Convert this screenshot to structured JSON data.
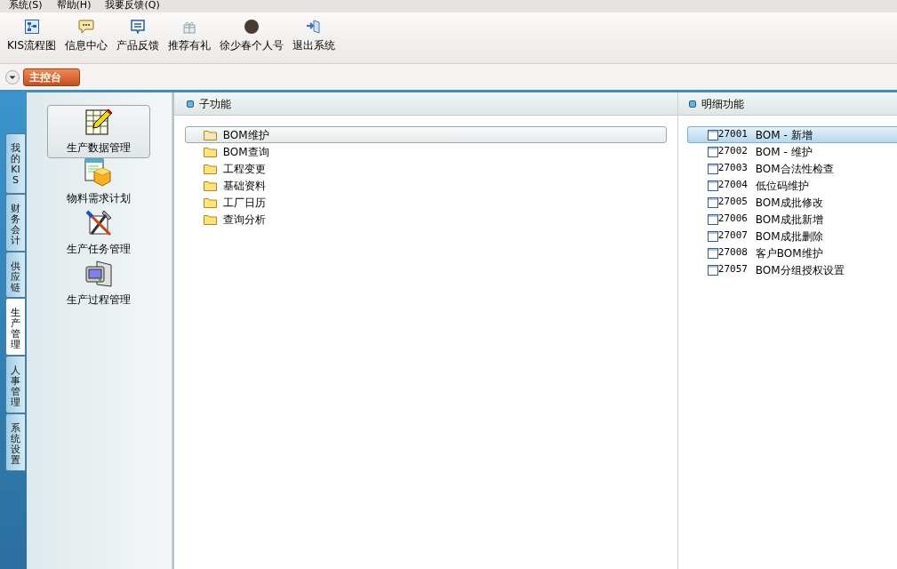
{
  "menu": [
    "系统(S)",
    "帮助(H)",
    "我要反馈(Q)"
  ],
  "toolbar": [
    {
      "label": "KIS流程图",
      "kind": "flow"
    },
    {
      "label": "信息中心",
      "kind": "message"
    },
    {
      "label": "产品反馈",
      "kind": "feedback"
    },
    {
      "label": "推荐有礼",
      "kind": "gift"
    },
    {
      "label": "徐少春个人号",
      "kind": "avatar"
    },
    {
      "label": "退出系统",
      "kind": "exit"
    }
  ],
  "tabs": [
    {
      "label": "主控台",
      "selected": true
    }
  ],
  "side_tabs": [
    {
      "label": "我的KIS",
      "selected": false
    },
    {
      "label": "财务会计",
      "selected": false
    },
    {
      "label": "供应链",
      "selected": false
    },
    {
      "label": "生产管理",
      "selected": true
    },
    {
      "label": "人事管理",
      "selected": false
    },
    {
      "label": "系统设置",
      "selected": false
    }
  ],
  "modules": [
    {
      "label": "生产数据管理",
      "kind": "table",
      "selected": true
    },
    {
      "label": "物料需求计划",
      "kind": "box",
      "selected": false
    },
    {
      "label": "生产任务管理",
      "kind": "tools",
      "selected": false
    },
    {
      "label": "生产过程管理",
      "kind": "terminal",
      "selected": false
    }
  ],
  "subfunctions": {
    "title": "子功能",
    "items": [
      {
        "label": "BOM维护",
        "selected": true
      },
      {
        "label": "BOM查询",
        "selected": false
      },
      {
        "label": "工程变更",
        "selected": false
      },
      {
        "label": "基础资料",
        "selected": false
      },
      {
        "label": "工厂日历",
        "selected": false
      },
      {
        "label": "查询分析",
        "selected": false
      }
    ]
  },
  "details": {
    "title": "明细功能",
    "items": [
      {
        "code": "27001",
        "label": "BOM - 新增",
        "selected": true
      },
      {
        "code": "27002",
        "label": "BOM - 维护",
        "selected": false
      },
      {
        "code": "27003",
        "label": "BOM合法性检查",
        "selected": false
      },
      {
        "code": "27004",
        "label": "低位码维护",
        "selected": false
      },
      {
        "code": "27005",
        "label": "BOM成批修改",
        "selected": false
      },
      {
        "code": "27006",
        "label": "BOM成批新增",
        "selected": false
      },
      {
        "code": "27007",
        "label": "BOM成批删除",
        "selected": false
      },
      {
        "code": "27008",
        "label": "客户BOM维护",
        "selected": false
      },
      {
        "code": "27057",
        "label": "BOM分组授权设置",
        "selected": false
      }
    ]
  }
}
